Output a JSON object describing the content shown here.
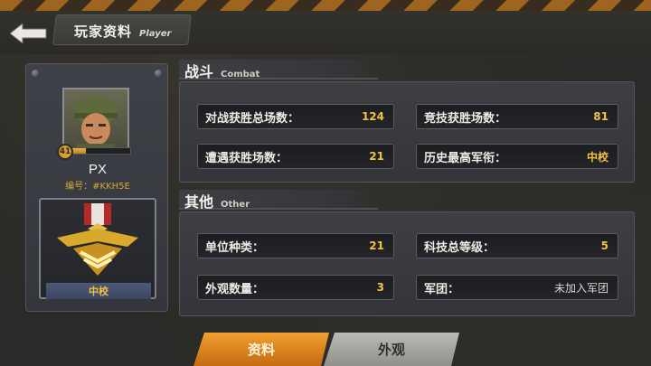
{
  "header": {
    "title_zh": "玩家资料",
    "title_en": "Player"
  },
  "profile": {
    "level": "41",
    "xp_progress": 0.25,
    "name": "PX",
    "id_label": "编号：#KKH5E",
    "rank": "中校"
  },
  "combat": {
    "title_zh": "战斗",
    "title_en": "Combat",
    "stats": [
      {
        "label": "对战获胜总场数：",
        "value": "124"
      },
      {
        "label": "竞技获胜场数：",
        "value": "81"
      },
      {
        "label": "遭遇获胜场数：",
        "value": "21"
      },
      {
        "label": "历史最高军衔：",
        "value": "中校"
      }
    ]
  },
  "other": {
    "title_zh": "其他",
    "title_en": "Other",
    "stats": [
      {
        "label": "单位种类：",
        "value": "21"
      },
      {
        "label": "科技总等级：",
        "value": "5"
      },
      {
        "label": "外观数量：",
        "value": "3"
      },
      {
        "label": "军团：",
        "value": "未加入军团"
      }
    ]
  },
  "tabs": [
    {
      "label": "资料",
      "active": true
    },
    {
      "label": "外观",
      "active": false
    }
  ],
  "colors": {
    "accent_orange": "#e08a22",
    "value_gold": "#f2c33f"
  }
}
